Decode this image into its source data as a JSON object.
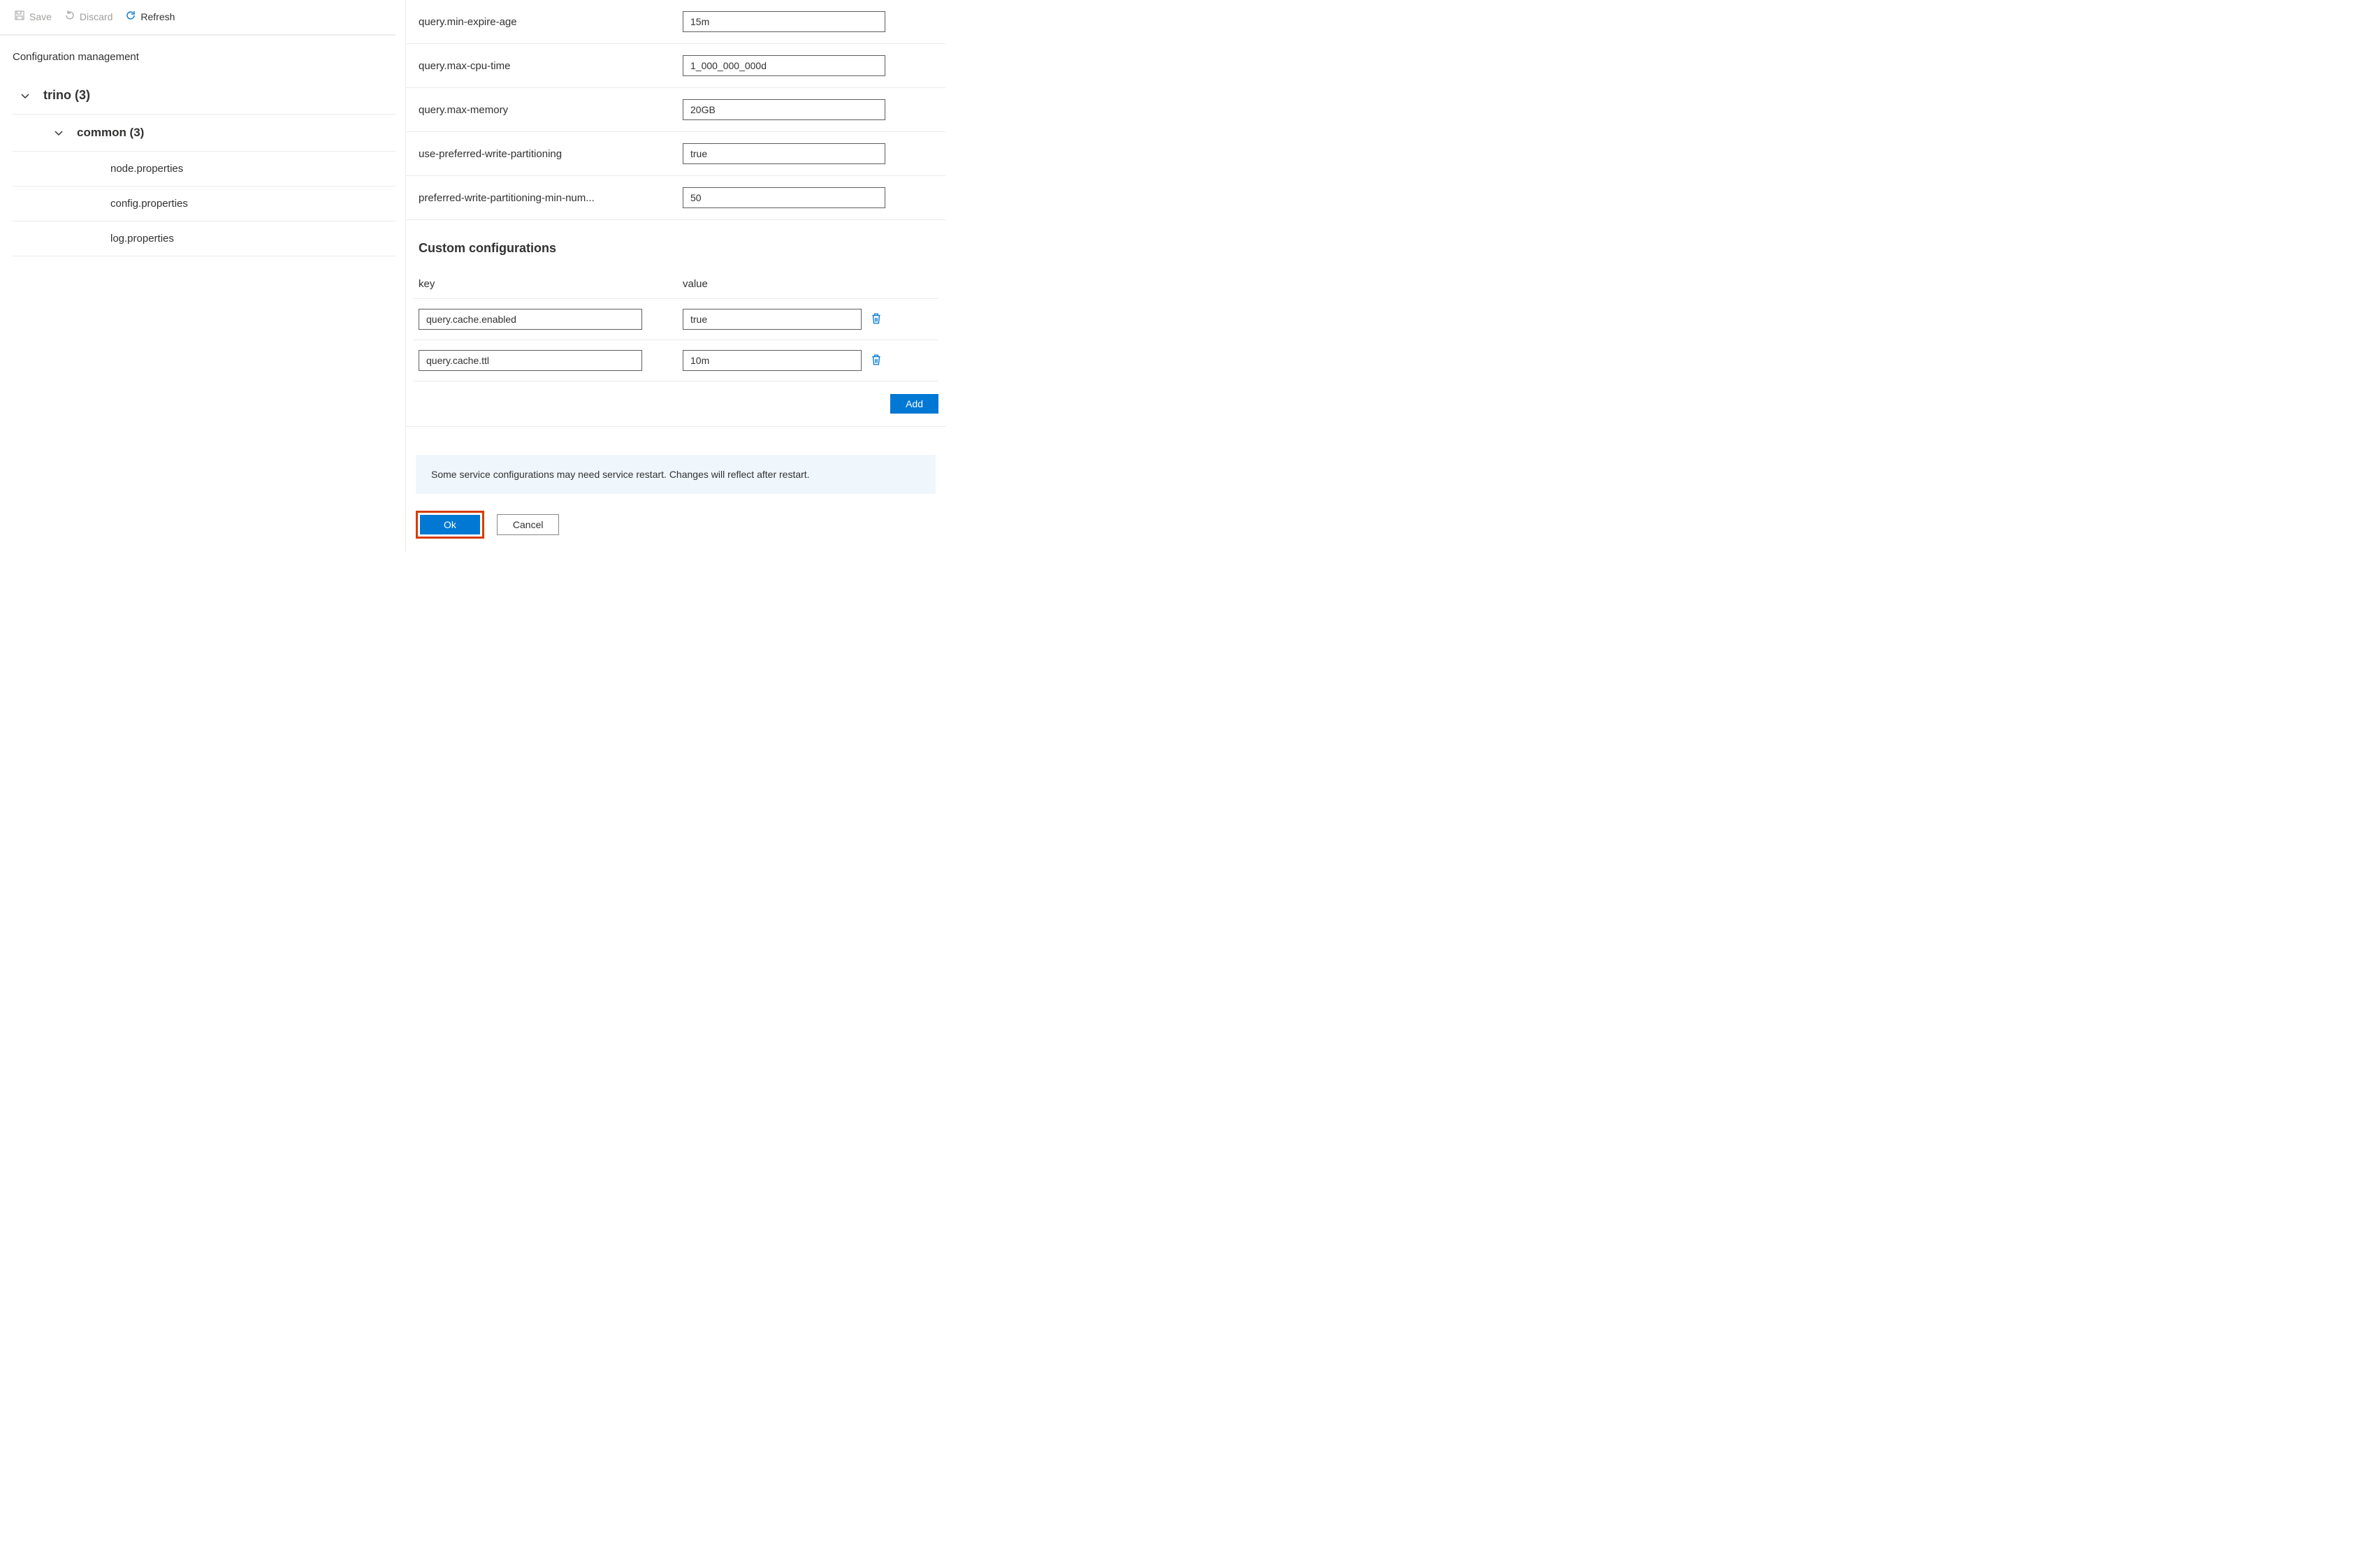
{
  "toolbar": {
    "save": "Save",
    "discard": "Discard",
    "refresh": "Refresh"
  },
  "section_title": "Configuration management",
  "tree": {
    "root": {
      "label": "trino (3)"
    },
    "child": {
      "label": "common (3)"
    },
    "leaves": [
      {
        "label": "node.properties"
      },
      {
        "label": "config.properties"
      },
      {
        "label": "log.properties"
      }
    ]
  },
  "configs": [
    {
      "label": "query.min-expire-age",
      "value": "15m"
    },
    {
      "label": "query.max-cpu-time",
      "value": "1_000_000_000d"
    },
    {
      "label": "query.max-memory",
      "value": "20GB"
    },
    {
      "label": "use-preferred-write-partitioning",
      "value": "true"
    },
    {
      "label": "preferred-write-partitioning-min-num...",
      "value": "50"
    }
  ],
  "custom": {
    "title": "Custom configurations",
    "key_header": "key",
    "value_header": "value",
    "rows": [
      {
        "key": "query.cache.enabled",
        "value": "true"
      },
      {
        "key": "query.cache.ttl",
        "value": "10m"
      }
    ],
    "add_label": "Add"
  },
  "banner": "Some service configurations may need service restart. Changes will reflect after restart.",
  "footer": {
    "ok": "Ok",
    "cancel": "Cancel"
  }
}
